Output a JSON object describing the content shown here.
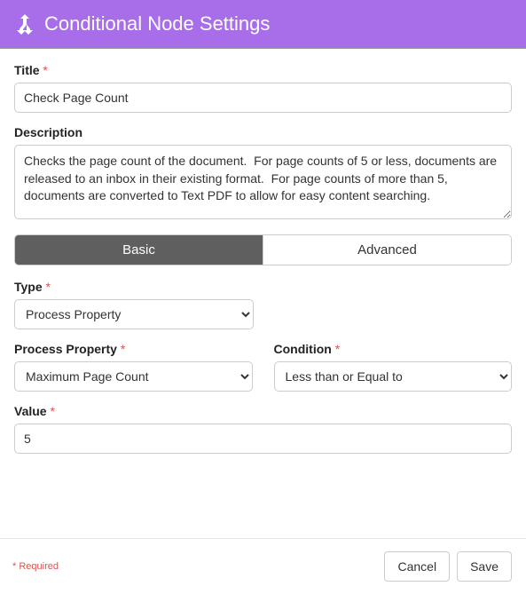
{
  "header": {
    "title": "Conditional Node Settings"
  },
  "form": {
    "title_label": "Title",
    "title_value": "Check Page Count",
    "description_label": "Description",
    "description_value": "Checks the page count of the document.  For page counts of 5 or less, documents are released to an inbox in their existing format.  For page counts of more than 5, documents are converted to Text PDF to allow for easy content searching.",
    "tabs": {
      "basic": "Basic",
      "advanced": "Advanced"
    },
    "type_label": "Type",
    "type_value": "Process Property",
    "process_property_label": "Process Property",
    "process_property_value": "Maximum Page Count",
    "condition_label": "Condition",
    "condition_value": "Less than or Equal to",
    "value_label": "Value",
    "value_value": "5"
  },
  "footer": {
    "required_note": "Required",
    "cancel": "Cancel",
    "save": "Save"
  }
}
